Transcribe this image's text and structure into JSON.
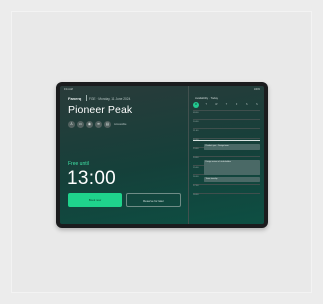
{
  "device": {
    "status_left": "9:41 AM",
    "status_right": "100%",
    "brand": "Fanerq",
    "date": "FGE · Monday, 11 June 2024",
    "room": "Pioneer Peak",
    "amenities": [
      {
        "icon": "person-icon",
        "glyph": "♙"
      },
      {
        "icon": "screen-icon",
        "glyph": "▭"
      },
      {
        "icon": "camera-icon",
        "glyph": "◉"
      },
      {
        "icon": "wifi-icon",
        "glyph": "≋"
      },
      {
        "icon": "board-icon",
        "glyph": "▤"
      }
    ],
    "amenities_caption": "Accessible",
    "free_label": "Free until",
    "free_time": "13:00",
    "primary_button": "Book now",
    "secondary_button": "Reserve for later"
  },
  "schedule": {
    "title": "Availability · Today",
    "days": [
      "M",
      "T",
      "W",
      "T",
      "F",
      "S",
      "S"
    ],
    "selected_day_index": 0,
    "times": [
      "09:00",
      "10:00",
      "11:00",
      "12:00",
      "13:00",
      "14:00",
      "15:00",
      "16:00",
      "17:00",
      "18:00"
    ],
    "events": [
      {
        "label": "Product sync · Design team",
        "slot_start": 4,
        "duration": 1
      },
      {
        "label": "Design review w/ stakeholders",
        "slot_start": 6,
        "duration": 2
      },
      {
        "label": "Team standup",
        "slot_start": 8,
        "duration": 0.8
      }
    ],
    "now_slot": 3.6
  }
}
